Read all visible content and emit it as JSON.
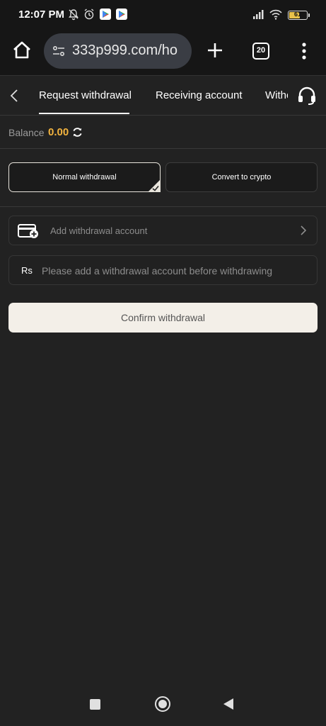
{
  "status_bar": {
    "time": "12:07 PM",
    "battery": "61",
    "icons": [
      "mute-bell-icon",
      "alarm-icon",
      "play-store-icon",
      "play-store-icon",
      "signal-icon",
      "wifi-icon",
      "battery-icon"
    ]
  },
  "browser": {
    "url": "333p999.com/ho",
    "tab_count": "20"
  },
  "nav": {
    "tabs": [
      {
        "label": "Request withdrawal",
        "active": true
      },
      {
        "label": "Receiving account",
        "active": false
      },
      {
        "label": "Witho",
        "active": false
      }
    ]
  },
  "balance": {
    "label": "Balance",
    "value": "0.00"
  },
  "modes": {
    "normal": "Normal withdrawal",
    "crypto": "Convert to crypto",
    "selected": "normal"
  },
  "form": {
    "account_placeholder": "Add withdrawal account",
    "currency": "Rs",
    "amount_placeholder": "Please add a withdrawal account before withdrawing",
    "amount_value": "",
    "confirm_label": "Confirm withdrawal"
  },
  "colors": {
    "background": "#222222",
    "accent_balance": "#f3b43f",
    "confirm_bg": "#f3efe8"
  }
}
